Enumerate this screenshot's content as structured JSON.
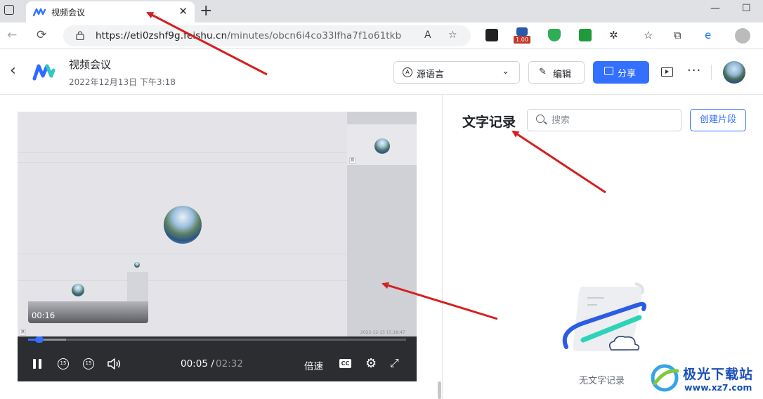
{
  "browser": {
    "tab_title": "视频会议",
    "url_host": "https://eti0zshf9g.feishu.cn",
    "url_path": "/minutes/obcn6i4co33lfha7f1o61tkb",
    "extension_badge": "1.00"
  },
  "header": {
    "title": "视频会议",
    "date": "2022年12月13日 下午3:18",
    "language_select": "源语言",
    "edit_label": "编辑",
    "share_label": "分享",
    "more_label": "···"
  },
  "video": {
    "preview_time": "00:16",
    "current_time": "00:05",
    "separator": "/",
    "total_time": "02:32",
    "speed_label": "倍速",
    "cc_label": "CC",
    "skip_back_label": "15",
    "skip_forward_label": "15",
    "tile_label": "音",
    "status_text": "2022-12-13 15:18:47",
    "progress_fraction": 0.03
  },
  "transcript": {
    "title": "文字记录",
    "search_placeholder": "搜索",
    "create_clip_label": "创建片段",
    "empty_text": "无文字记录"
  },
  "watermark": {
    "name": "极光下载站",
    "url": "www.xz7.com"
  },
  "colors": {
    "accent": "#3370ff",
    "annotation_arrow": "#d42020",
    "control_bar": "#2b2d31"
  }
}
